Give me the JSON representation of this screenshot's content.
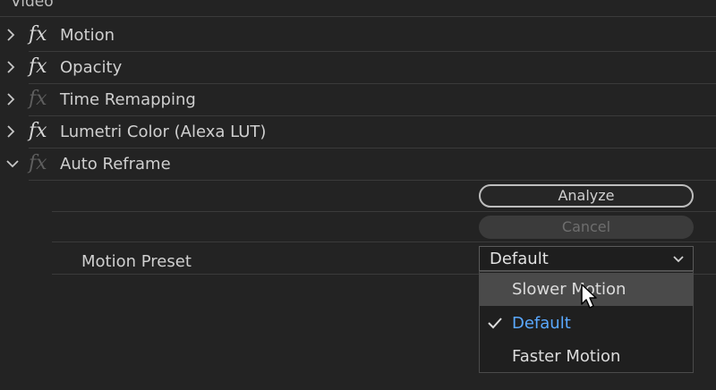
{
  "panel": {
    "section_label": "Video"
  },
  "effects": [
    {
      "label": "Motion",
      "expanded": false,
      "enabled": true
    },
    {
      "label": "Opacity",
      "expanded": false,
      "enabled": true
    },
    {
      "label": "Time Remapping",
      "expanded": false,
      "enabled": false
    },
    {
      "label": "Lumetri Color (Alexa LUT)",
      "expanded": false,
      "enabled": true
    },
    {
      "label": "Auto Reframe",
      "expanded": true,
      "enabled": false
    }
  ],
  "auto_reframe": {
    "analyze_label": "Analyze",
    "cancel_label": "Cancel",
    "motion_preset_label": "Motion Preset",
    "motion_preset_value": "Default",
    "options": [
      "Slower Motion",
      "Default",
      "Faster Motion"
    ],
    "hovered_option": "Slower Motion",
    "selected_option": "Default"
  },
  "colors": {
    "accent": "#5aa9ff",
    "background": "#232323",
    "hover": "#4a4a4a"
  }
}
